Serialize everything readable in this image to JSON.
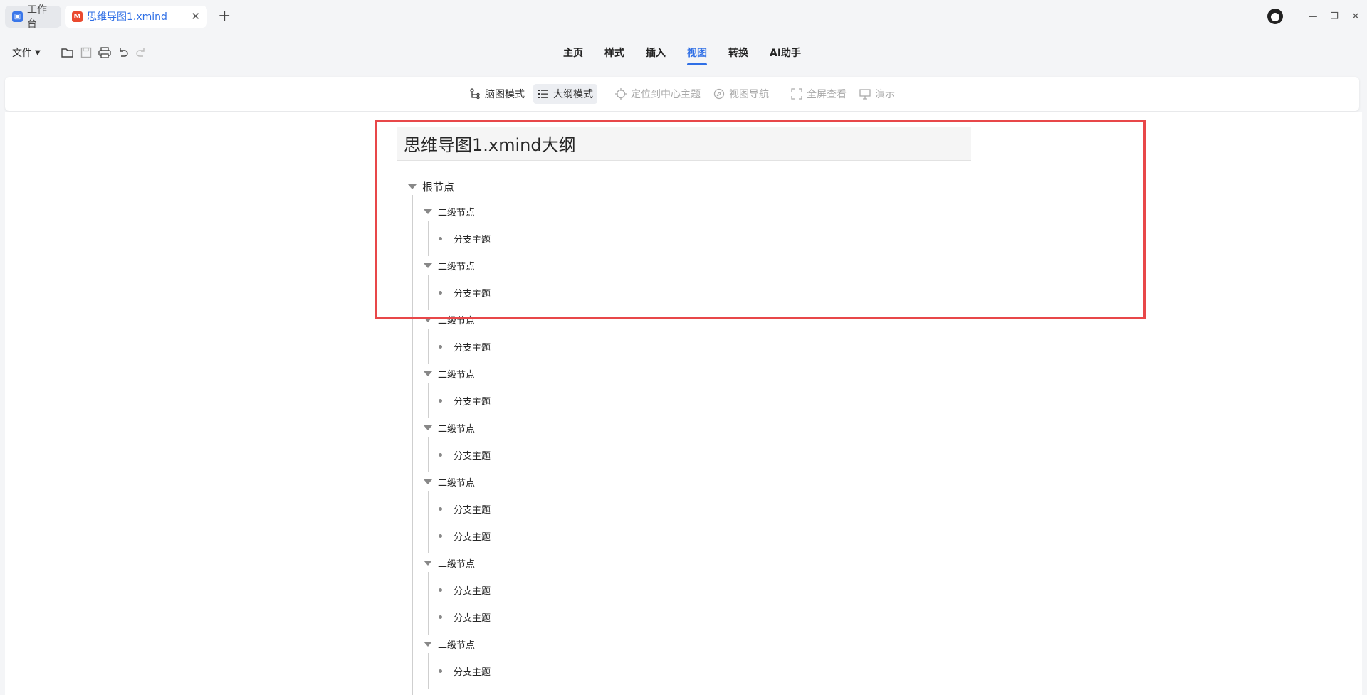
{
  "tabs": {
    "workspace": "工作台",
    "document": "思维导图1.xmind"
  },
  "menubar": {
    "file": "文件"
  },
  "main_tabs": [
    "主页",
    "样式",
    "插入",
    "视图",
    "转换",
    "AI助手"
  ],
  "selected_main_tab": "视图",
  "ribbon": {
    "mindmap_mode": "脑图模式",
    "outline_mode": "大纲模式",
    "locate_center": "定位到中心主题",
    "view_nav": "视图导航",
    "fullscreen": "全屏查看",
    "present": "演示"
  },
  "outline": {
    "title": "思维导图1.xmind大纲",
    "root": "根节点",
    "branches": [
      {
        "label": "二级节点",
        "children": [
          "分支主题"
        ]
      },
      {
        "label": "二级节点",
        "children": [
          "分支主题"
        ]
      },
      {
        "label": "二级节点",
        "children": [
          "分支主题"
        ]
      },
      {
        "label": "二级节点",
        "children": [
          "分支主题"
        ]
      },
      {
        "label": "二级节点",
        "children": [
          "分支主题"
        ]
      },
      {
        "label": "二级节点",
        "children": [
          "分支主题",
          "分支主题"
        ]
      },
      {
        "label": "二级节点",
        "children": [
          "分支主题",
          "分支主题"
        ]
      },
      {
        "label": "二级节点",
        "children": [
          "分支主题"
        ]
      }
    ]
  },
  "colors": {
    "accent": "#2f6fe6",
    "highlight": "#e84749"
  }
}
